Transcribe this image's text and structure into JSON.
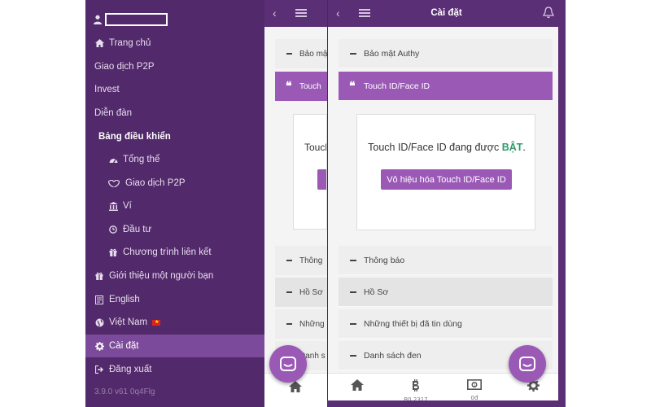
{
  "drawer": {
    "items": [
      {
        "label": "Trang chủ",
        "icon": "home-icon"
      },
      {
        "label": "Giao dịch P2P"
      },
      {
        "label": "Invest"
      },
      {
        "label": "Diễn đàn"
      },
      {
        "label": "Bảng điều khiển"
      },
      {
        "label": "Tổng thể",
        "icon": "dashboard-icon"
      },
      {
        "label": "Giao dịch P2P",
        "icon": "handshake-icon"
      },
      {
        "label": "Ví",
        "icon": "bank-icon"
      },
      {
        "label": "Đầu tư",
        "icon": "clock-icon"
      },
      {
        "label": "Chương trình liên kết",
        "icon": "gift-icon"
      },
      {
        "label": "Giới thiệu một người bạn",
        "icon": "gift-icon"
      },
      {
        "label": "English",
        "icon": "flag-book-icon"
      },
      {
        "label": "Việt Nam",
        "icon": "globe-icon"
      },
      {
        "label": "Cài đặt",
        "icon": "gear-icon",
        "active": true
      },
      {
        "label": "Đăng xuất",
        "icon": "sign-out-icon"
      }
    ],
    "version": "3.9.0 v61 0q4Flg"
  },
  "peek": {
    "sections": [
      "Bảo mậ",
      "Touch",
      "Thông",
      "Hồ Sơ",
      "Những",
      "Danh s"
    ],
    "card_text": "Touch"
  },
  "settings": {
    "title": "Cài đặt",
    "sections": [
      {
        "label": "Bảo mật Authy"
      },
      {
        "label": "Touch ID/Face ID",
        "active": true
      },
      {
        "label": "Thông báo"
      },
      {
        "label": "Hồ Sơ"
      },
      {
        "label": "Những thiết bị đã tin dùng"
      },
      {
        "label": "Danh sách đen"
      }
    ],
    "card": {
      "status_prefix": "Touch ID/Face ID đang được ",
      "status_value": "BẬT",
      "status_suffix": ".",
      "button": "Vô hiệu hóa Touch ID/Face ID"
    }
  },
  "tabbar": {
    "items": [
      {
        "icon": "home-icon",
        "label": ""
      },
      {
        "icon": "bitcoin-icon",
        "label": "B0.2317"
      },
      {
        "icon": "cash-icon",
        "label": "0đ"
      },
      {
        "icon": "gear-icon",
        "label": ""
      }
    ]
  },
  "colors": {
    "brand_purple": "#5b2f75",
    "accent_purple": "#9b59b6",
    "status_on_green": "#2e9a6a"
  }
}
